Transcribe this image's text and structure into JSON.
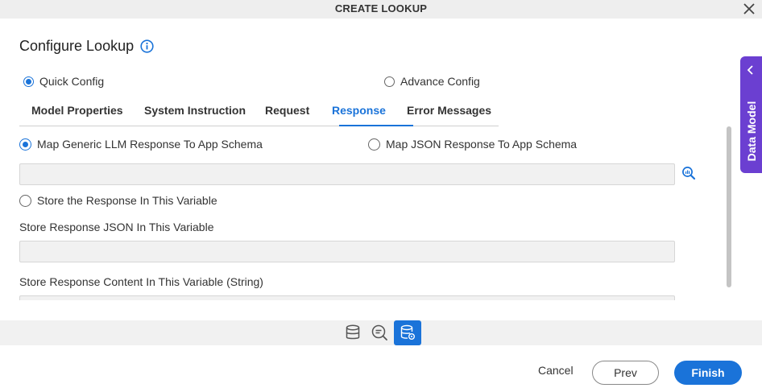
{
  "dialog": {
    "title": "CREATE LOOKUP"
  },
  "heading": "Configure Lookup",
  "config_mode": {
    "quick": "Quick Config",
    "advance": "Advance Config",
    "selected": "quick"
  },
  "tabs": [
    {
      "label": "Model Properties"
    },
    {
      "label": "System Instruction"
    },
    {
      "label": "Request"
    },
    {
      "label": "Response",
      "active": true
    },
    {
      "label": "Error Messages"
    }
  ],
  "response": {
    "map_generic": "Map Generic LLM Response To App Schema",
    "map_json": "Map JSON Response To App Schema",
    "store_variable": "Store the Response In This Variable",
    "store_json_label": "Store Response JSON In This Variable",
    "store_content_label": "Store Response Content In This Variable (String)",
    "selected": "map_generic"
  },
  "side_panel": {
    "label": "Data Model"
  },
  "bottom_icons": [
    "database-icon",
    "variable-search-icon",
    "database-settings-icon"
  ],
  "footer": {
    "cancel": "Cancel",
    "prev": "Prev",
    "finish": "Finish"
  },
  "colors": {
    "accent": "#1a73d9",
    "side_panel": "#6b3fd1"
  }
}
